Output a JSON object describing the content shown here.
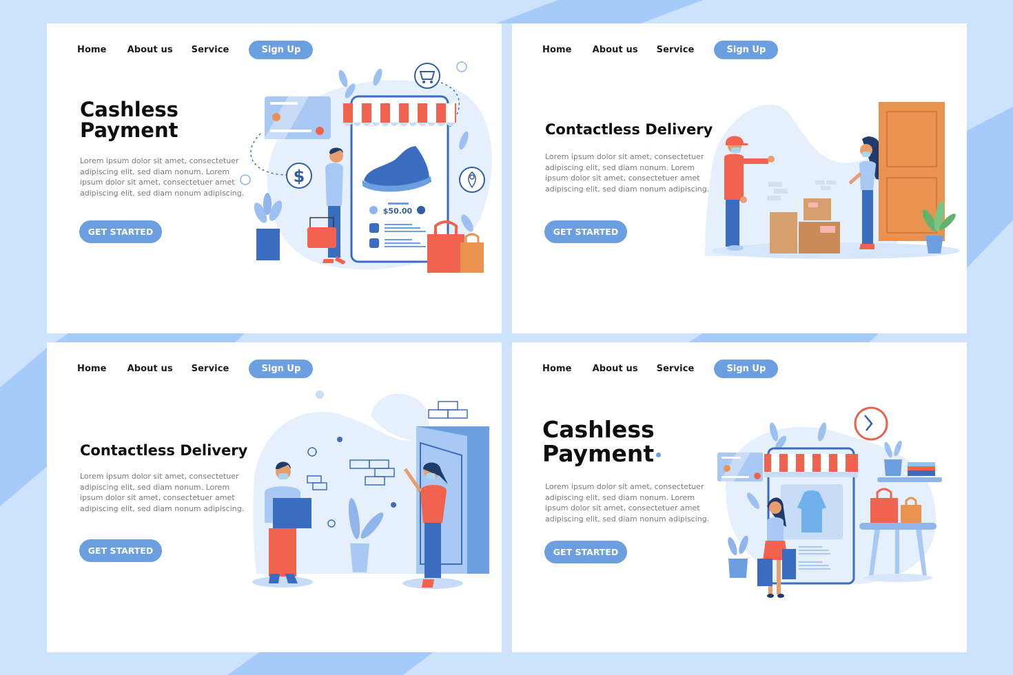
{
  "colors": {
    "background": "#cde2fc",
    "stripe": "#a6cbfb",
    "accent": "#6b9fdf",
    "dark_blue": "#3a6dbf",
    "red": "#f2634f",
    "orange": "#ea9250",
    "light_blue_blob": "#e6f0fd"
  },
  "panels": [
    {
      "id": "cashless-payment-1",
      "nav": {
        "home": "Home",
        "about": "About us",
        "service": "Service",
        "signup": "Sign Up"
      },
      "title_line1": "Cashless",
      "title_line2": "Payment",
      "body": "Lorem ipsum dolor sit amet, consectetuer adipiscing elit, sed diam nonum. Lorem ipsum dolor sit amet, consectetuer amet adipiscing elit, sed diam nonum adipiscing.",
      "cta": "GET STARTED",
      "illustration": {
        "price": "$50.00",
        "icons": [
          "credit-card-icon",
          "dollar-icon",
          "cart-icon",
          "location-pin-icon",
          "shoe-icon",
          "shopping-bag-icon",
          "basket-icon",
          "plant-icon"
        ]
      }
    },
    {
      "id": "contactless-delivery-1",
      "nav": {
        "home": "Home",
        "about": "About us",
        "service": "Service",
        "signup": "Sign Up"
      },
      "title": "Contactless Delivery",
      "body": "Lorem ipsum dolor sit amet, consectetuer adipiscing elit, sed diam nonum. Lorem ipsum dolor sit amet, consectetuer amet adipiscing elit, sed diam nonum adipiscing.",
      "cta": "GET STARTED",
      "illustration": {
        "icons": [
          "courier-icon",
          "boxes-icon",
          "door-icon",
          "customer-icon",
          "plant-icon"
        ]
      }
    },
    {
      "id": "contactless-delivery-2",
      "nav": {
        "home": "Home",
        "about": "About us",
        "service": "Service",
        "signup": "Sign Up"
      },
      "title": "Contactless Delivery",
      "body": "Lorem ipsum dolor sit amet, consectetuer adipiscing elit, sed diam nonum. Lorem ipsum dolor sit amet, consectetuer amet adipiscing elit, sed diam nonum adipiscing.",
      "cta": "GET STARTED",
      "illustration": {
        "icons": [
          "courier-icon",
          "package-icon",
          "door-icon",
          "customer-icon",
          "bricks-icon",
          "plant-icon"
        ]
      }
    },
    {
      "id": "cashless-payment-2",
      "nav": {
        "home": "Home",
        "about": "About us",
        "service": "Service",
        "signup": "Sign Up"
      },
      "title_line1": "Cashless",
      "title_line2": "Payment",
      "body": "Lorem ipsum dolor sit amet, consectetuer adipiscing elit, sed diam nonum. Lorem ipsum dolor sit amet, consectetuer amet adipiscing elit, sed diam nonum adipiscing.",
      "cta": "GET STARTED",
      "illustration": {
        "icons": [
          "clock-icon",
          "storefront-icon",
          "dress-icon",
          "credit-card-icon",
          "shopper-icon",
          "shopping-bag-icon",
          "table-icon",
          "books-icon",
          "plant-icon"
        ]
      }
    }
  ]
}
